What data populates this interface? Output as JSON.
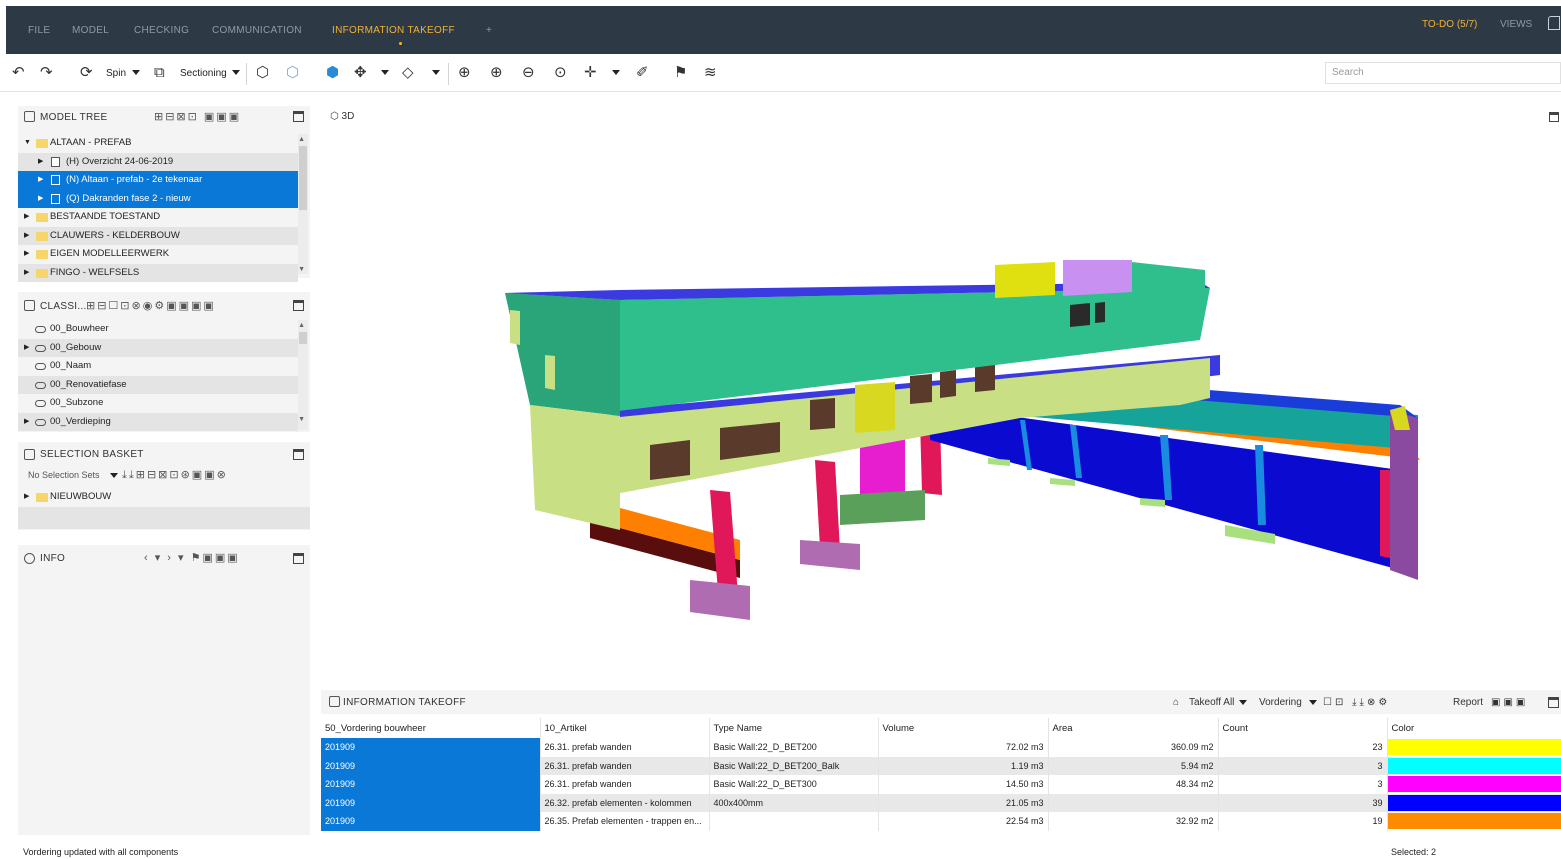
{
  "menu": {
    "items": [
      "FILE",
      "MODEL",
      "CHECKING",
      "COMMUNICATION",
      "INFORMATION TAKEOFF"
    ],
    "plus": "+",
    "todo": "TO-DO (5/7)",
    "views": "VIEWS",
    "colors": {
      "bar": "#2d3a46",
      "active": "#f2b233",
      "inactive": "#8e9aa6"
    }
  },
  "toolbar": {
    "spin_label": "Spin",
    "sectioning_label": "Sectioning",
    "search_placeholder": "Search",
    "icons": [
      "undo-icon",
      "redo-icon",
      "spin-icon",
      "sectioning-icon",
      "visibility-icon",
      "hide-icon",
      "isolate-icon",
      "select-icon",
      "box-icon",
      "zoom-fit-icon",
      "zoom-in-icon",
      "zoom-out-icon",
      "zoom-window-icon",
      "pick-icon",
      "measure-icon",
      "map-icon",
      "layers-icon"
    ]
  },
  "model_tree": {
    "title": "MODEL TREE",
    "items": [
      {
        "label": "ALTAAN - PREFAB",
        "level": 0,
        "expanded": true,
        "state": "normal"
      },
      {
        "label": "(H) Overzicht 24-06-2019",
        "level": 1,
        "state": "alt"
      },
      {
        "label": "(N) Altaan - prefab - 2e tekenaar",
        "level": 1,
        "state": "selected"
      },
      {
        "label": "(Q) Dakranden fase 2 - nieuw",
        "level": 1,
        "state": "selected"
      },
      {
        "label": "BESTAANDE TOESTAND",
        "level": 0,
        "state": "normal"
      },
      {
        "label": "CLAUWERS - KELDERBOUW",
        "level": 0,
        "state": "alt"
      },
      {
        "label": "EIGEN MODELLEERWERK",
        "level": 0,
        "state": "normal"
      },
      {
        "label": "FINGO - WELFSELS",
        "level": 0,
        "state": "alt"
      }
    ]
  },
  "classifications": {
    "title": "CLASSI...",
    "items": [
      {
        "label": "00_Bouwheer",
        "expandable": false,
        "state": "normal"
      },
      {
        "label": "00_Gebouw",
        "expandable": true,
        "state": "alt"
      },
      {
        "label": "00_Naam",
        "expandable": false,
        "state": "normal"
      },
      {
        "label": "00_Renovatiefase",
        "expandable": false,
        "state": "alt"
      },
      {
        "label": "00_Subzone",
        "expandable": false,
        "state": "normal"
      },
      {
        "label": "00_Verdieping",
        "expandable": true,
        "state": "alt"
      }
    ]
  },
  "selection_basket": {
    "title": "SELECTION BASKET",
    "selection_sets": "No Selection Sets",
    "items": [
      {
        "label": "NIEUWBOUW"
      }
    ]
  },
  "info": {
    "title": "INFO"
  },
  "view": {
    "label": "3D"
  },
  "takeoff": {
    "title": "INFORMATION TAKEOFF",
    "takeoff_all": "Takeoff All",
    "vordering": "Vordering",
    "report": "Report",
    "columns": [
      "50_Vordering bouwheer",
      "10_Artikel",
      "Type Name",
      "Volume",
      "Area",
      "Count",
      "Color"
    ],
    "rows": [
      {
        "vordering": "201909",
        "artikel": "26.31. prefab wanden",
        "type": "Basic Wall:22_D_BET200",
        "volume": "72.02 m3",
        "area": "360.09 m2",
        "count": "23",
        "color": "#ffff00"
      },
      {
        "vordering": "201909",
        "artikel": "26.31. prefab wanden",
        "type": "Basic Wall:22_D_BET200_Balk",
        "volume": "1.19 m3",
        "area": "5.94 m2",
        "count": "3",
        "color": "#00ffff"
      },
      {
        "vordering": "201909",
        "artikel": "26.31. prefab wanden",
        "type": "Basic Wall:22_D_BET300",
        "volume": "14.50 m3",
        "area": "48.34 m2",
        "count": "3",
        "color": "#ff00ff"
      },
      {
        "vordering": "201909",
        "artikel": "26.32. prefab elementen - kolommen",
        "type": "400x400mm",
        "volume": "21.05 m3",
        "area": "",
        "count": "39",
        "color": "#0000ff"
      },
      {
        "vordering": "201909",
        "artikel": "26.35. Prefab elementen - trappen en...",
        "type": "",
        "volume": "22.54 m3",
        "area": "32.92 m2",
        "count": "19",
        "color": "#ff8c00"
      }
    ]
  },
  "status": {
    "left": "Vordering updated with all components",
    "right": "Selected: 2"
  }
}
